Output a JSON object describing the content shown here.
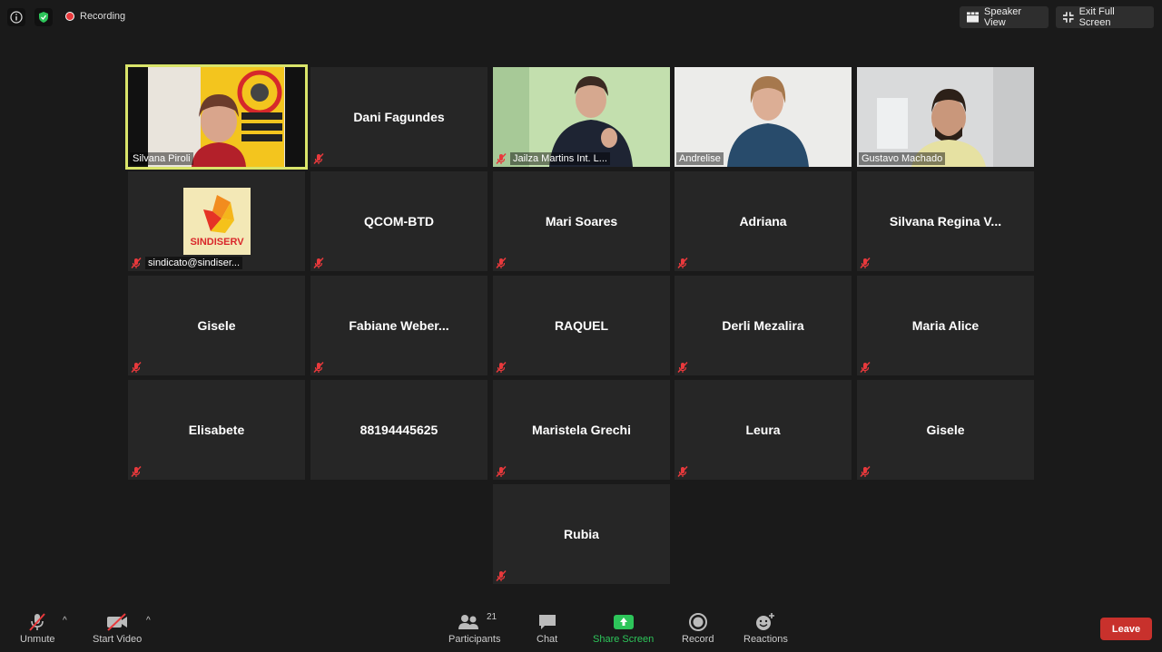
{
  "topbar": {
    "recording_label": "Recording",
    "speaker_view_label": "Speaker View",
    "exit_fullscreen_label": "Exit Full Screen"
  },
  "participants": [
    {
      "name": "Silvana Piroli"
    },
    {
      "name": "Dani Fagundes"
    },
    {
      "name": "Jailza Martins Int. L..."
    },
    {
      "name": "Andrelise"
    },
    {
      "name": "Gustavo Machado"
    },
    {
      "name": "sindicato@sindiser..."
    },
    {
      "name": "QCOM-BTD"
    },
    {
      "name": "Mari Soares"
    },
    {
      "name": "Adriana"
    },
    {
      "name": "Silvana Regina V..."
    },
    {
      "name": "Gisele"
    },
    {
      "name": "Fabiane Weber..."
    },
    {
      "name": "RAQUEL"
    },
    {
      "name": "Derli Mezalira"
    },
    {
      "name": "Maria Alice"
    },
    {
      "name": "Elisabete"
    },
    {
      "name": "88194445625"
    },
    {
      "name": "Maristela Grechi"
    },
    {
      "name": "Leura"
    },
    {
      "name": "Gisele"
    },
    {
      "name": "Rubia"
    }
  ],
  "sindiserv_logo_text": "SINDISERV",
  "bottombar": {
    "unmute_label": "Unmute",
    "start_video_label": "Start Video",
    "participants_label": "Participants",
    "participants_count": "21",
    "chat_label": "Chat",
    "share_screen_label": "Share Screen",
    "record_label": "Record",
    "reactions_label": "Reactions",
    "leave_label": "Leave"
  },
  "colors": {
    "active_speaker_border": "#d9e46a",
    "share_screen_green": "#2dc55a",
    "leave_red": "#c8312c",
    "muted_red": "#e8393c"
  }
}
